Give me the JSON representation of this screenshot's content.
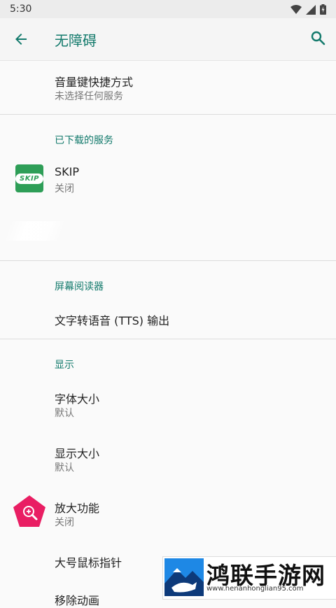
{
  "status": {
    "time": "5:30"
  },
  "header": {
    "title": "无障碍"
  },
  "items": {
    "volume_shortcut": {
      "title": "音量键快捷方式",
      "subtitle": "未选择任何服务"
    },
    "skip": {
      "title": "SKIP",
      "subtitle": "关闭",
      "icon_text": "SKIP"
    },
    "tts": {
      "title": "文字转语音 (TTS) 输出"
    },
    "font_size": {
      "title": "字体大小",
      "subtitle": "默认"
    },
    "display_size": {
      "title": "显示大小",
      "subtitle": "默认"
    },
    "magnification": {
      "title": "放大功能",
      "subtitle": "关闭"
    },
    "large_pointer": {
      "title": "大号鼠标指针"
    },
    "remove_animations": {
      "title": "移除动画"
    }
  },
  "sections": {
    "downloaded": "已下载的服务",
    "screen_reader": "屏幕阅读器",
    "display": "显示"
  },
  "watermark": {
    "title": "鸿联手游网",
    "url": "www.henanhonglian95.com"
  },
  "colors": {
    "accent": "#137a6c",
    "skip_green": "#2e9e57",
    "magnify_pink": "#e91e63"
  }
}
